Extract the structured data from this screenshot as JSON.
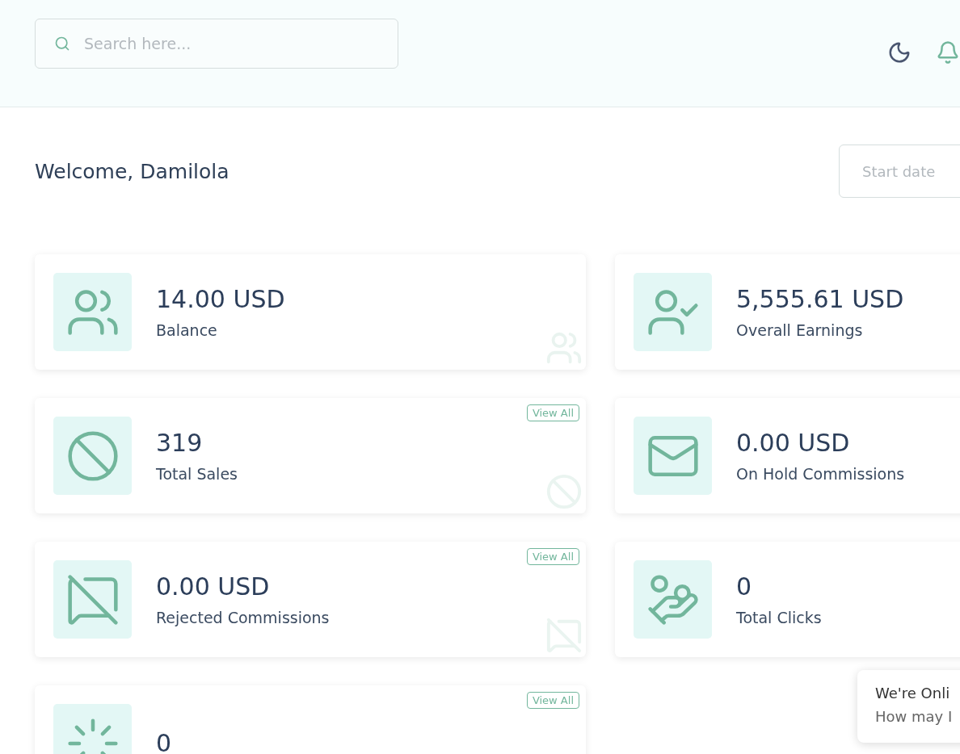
{
  "header": {
    "search": {
      "placeholder": "Search here..."
    }
  },
  "welcome": "Welcome, Damilola",
  "date_range": {
    "placeholder": "Start date"
  },
  "cards": [
    {
      "value": "14.00 USD",
      "label": "Balance"
    },
    {
      "value": "5,555.61 USD",
      "label": "Overall Earnings"
    },
    {
      "value": "319",
      "label": "Total Sales",
      "action": "View All"
    },
    {
      "value": "0.00 USD",
      "label": "On Hold Commissions"
    },
    {
      "value": "0.00 USD",
      "label": "Rejected Commissions",
      "action": "View All"
    },
    {
      "value": "0",
      "label": "Total Clicks"
    },
    {
      "value": "0",
      "action": "View All"
    }
  ],
  "chat": {
    "title": "We're Onli",
    "subtitle": "How may I"
  }
}
